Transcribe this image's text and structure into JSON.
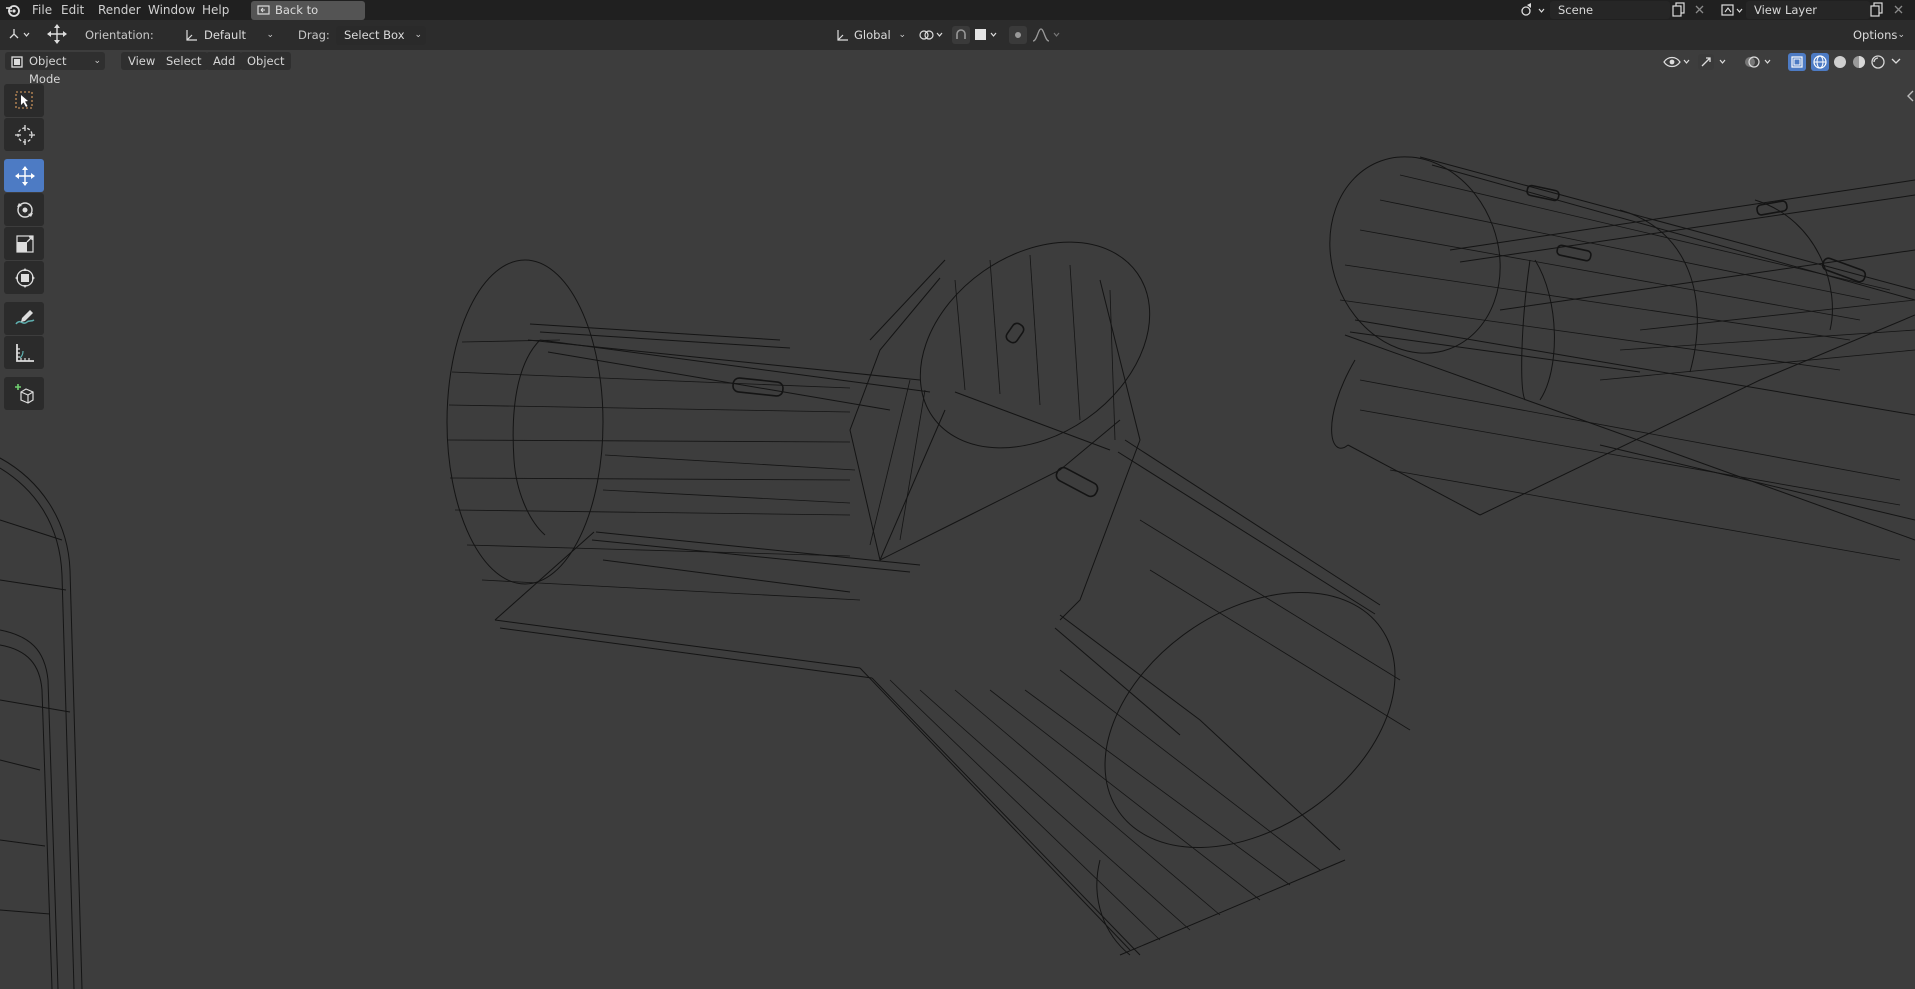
{
  "topbar": {
    "menus": [
      "File",
      "Edit",
      "Render",
      "Window",
      "Help"
    ],
    "back_button": "Back to Previous",
    "scene": {
      "value": "Scene"
    },
    "view_layer": {
      "value": "View Layer"
    }
  },
  "tool_header": {
    "orientation_label": "Orientation:",
    "orientation_value": "Default",
    "drag_label": "Drag:",
    "drag_value": "Select Box",
    "transform_orientation": "Global",
    "options": "Options"
  },
  "viewport_header": {
    "mode": "Object Mode",
    "menus": [
      "View",
      "Select",
      "Add",
      "Object"
    ]
  },
  "toolbar": {
    "tools": [
      "select-box-icon",
      "cursor-icon",
      "move-icon",
      "rotate-icon",
      "scale-icon",
      "transform-icon",
      "annotate-icon",
      "measure-icon",
      "add-cube-icon"
    ],
    "active_tool": "move-icon"
  },
  "colors": {
    "viewport_bg": "#3d3d3d",
    "topbar_bg": "#202020",
    "active_tool": "#4d7bc4",
    "wire": "#141414"
  }
}
